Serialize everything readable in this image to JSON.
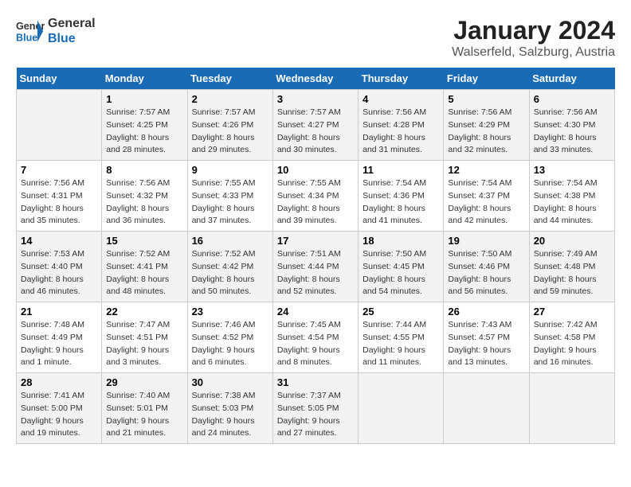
{
  "logo": {
    "text_general": "General",
    "text_blue": "Blue"
  },
  "title": "January 2024",
  "subtitle": "Walserfeld, Salzburg, Austria",
  "weekdays": [
    "Sunday",
    "Monday",
    "Tuesday",
    "Wednesday",
    "Thursday",
    "Friday",
    "Saturday"
  ],
  "weeks": [
    [
      {
        "day": "",
        "sunrise": "",
        "sunset": "",
        "daylight": ""
      },
      {
        "day": "1",
        "sunrise": "Sunrise: 7:57 AM",
        "sunset": "Sunset: 4:25 PM",
        "daylight": "Daylight: 8 hours and 28 minutes."
      },
      {
        "day": "2",
        "sunrise": "Sunrise: 7:57 AM",
        "sunset": "Sunset: 4:26 PM",
        "daylight": "Daylight: 8 hours and 29 minutes."
      },
      {
        "day": "3",
        "sunrise": "Sunrise: 7:57 AM",
        "sunset": "Sunset: 4:27 PM",
        "daylight": "Daylight: 8 hours and 30 minutes."
      },
      {
        "day": "4",
        "sunrise": "Sunrise: 7:56 AM",
        "sunset": "Sunset: 4:28 PM",
        "daylight": "Daylight: 8 hours and 31 minutes."
      },
      {
        "day": "5",
        "sunrise": "Sunrise: 7:56 AM",
        "sunset": "Sunset: 4:29 PM",
        "daylight": "Daylight: 8 hours and 32 minutes."
      },
      {
        "day": "6",
        "sunrise": "Sunrise: 7:56 AM",
        "sunset": "Sunset: 4:30 PM",
        "daylight": "Daylight: 8 hours and 33 minutes."
      }
    ],
    [
      {
        "day": "7",
        "sunrise": "Sunrise: 7:56 AM",
        "sunset": "Sunset: 4:31 PM",
        "daylight": "Daylight: 8 hours and 35 minutes."
      },
      {
        "day": "8",
        "sunrise": "Sunrise: 7:56 AM",
        "sunset": "Sunset: 4:32 PM",
        "daylight": "Daylight: 8 hours and 36 minutes."
      },
      {
        "day": "9",
        "sunrise": "Sunrise: 7:55 AM",
        "sunset": "Sunset: 4:33 PM",
        "daylight": "Daylight: 8 hours and 37 minutes."
      },
      {
        "day": "10",
        "sunrise": "Sunrise: 7:55 AM",
        "sunset": "Sunset: 4:34 PM",
        "daylight": "Daylight: 8 hours and 39 minutes."
      },
      {
        "day": "11",
        "sunrise": "Sunrise: 7:54 AM",
        "sunset": "Sunset: 4:36 PM",
        "daylight": "Daylight: 8 hours and 41 minutes."
      },
      {
        "day": "12",
        "sunrise": "Sunrise: 7:54 AM",
        "sunset": "Sunset: 4:37 PM",
        "daylight": "Daylight: 8 hours and 42 minutes."
      },
      {
        "day": "13",
        "sunrise": "Sunrise: 7:54 AM",
        "sunset": "Sunset: 4:38 PM",
        "daylight": "Daylight: 8 hours and 44 minutes."
      }
    ],
    [
      {
        "day": "14",
        "sunrise": "Sunrise: 7:53 AM",
        "sunset": "Sunset: 4:40 PM",
        "daylight": "Daylight: 8 hours and 46 minutes."
      },
      {
        "day": "15",
        "sunrise": "Sunrise: 7:52 AM",
        "sunset": "Sunset: 4:41 PM",
        "daylight": "Daylight: 8 hours and 48 minutes."
      },
      {
        "day": "16",
        "sunrise": "Sunrise: 7:52 AM",
        "sunset": "Sunset: 4:42 PM",
        "daylight": "Daylight: 8 hours and 50 minutes."
      },
      {
        "day": "17",
        "sunrise": "Sunrise: 7:51 AM",
        "sunset": "Sunset: 4:44 PM",
        "daylight": "Daylight: 8 hours and 52 minutes."
      },
      {
        "day": "18",
        "sunrise": "Sunrise: 7:50 AM",
        "sunset": "Sunset: 4:45 PM",
        "daylight": "Daylight: 8 hours and 54 minutes."
      },
      {
        "day": "19",
        "sunrise": "Sunrise: 7:50 AM",
        "sunset": "Sunset: 4:46 PM",
        "daylight": "Daylight: 8 hours and 56 minutes."
      },
      {
        "day": "20",
        "sunrise": "Sunrise: 7:49 AM",
        "sunset": "Sunset: 4:48 PM",
        "daylight": "Daylight: 8 hours and 59 minutes."
      }
    ],
    [
      {
        "day": "21",
        "sunrise": "Sunrise: 7:48 AM",
        "sunset": "Sunset: 4:49 PM",
        "daylight": "Daylight: 9 hours and 1 minute."
      },
      {
        "day": "22",
        "sunrise": "Sunrise: 7:47 AM",
        "sunset": "Sunset: 4:51 PM",
        "daylight": "Daylight: 9 hours and 3 minutes."
      },
      {
        "day": "23",
        "sunrise": "Sunrise: 7:46 AM",
        "sunset": "Sunset: 4:52 PM",
        "daylight": "Daylight: 9 hours and 6 minutes."
      },
      {
        "day": "24",
        "sunrise": "Sunrise: 7:45 AM",
        "sunset": "Sunset: 4:54 PM",
        "daylight": "Daylight: 9 hours and 8 minutes."
      },
      {
        "day": "25",
        "sunrise": "Sunrise: 7:44 AM",
        "sunset": "Sunset: 4:55 PM",
        "daylight": "Daylight: 9 hours and 11 minutes."
      },
      {
        "day": "26",
        "sunrise": "Sunrise: 7:43 AM",
        "sunset": "Sunset: 4:57 PM",
        "daylight": "Daylight: 9 hours and 13 minutes."
      },
      {
        "day": "27",
        "sunrise": "Sunrise: 7:42 AM",
        "sunset": "Sunset: 4:58 PM",
        "daylight": "Daylight: 9 hours and 16 minutes."
      }
    ],
    [
      {
        "day": "28",
        "sunrise": "Sunrise: 7:41 AM",
        "sunset": "Sunset: 5:00 PM",
        "daylight": "Daylight: 9 hours and 19 minutes."
      },
      {
        "day": "29",
        "sunrise": "Sunrise: 7:40 AM",
        "sunset": "Sunset: 5:01 PM",
        "daylight": "Daylight: 9 hours and 21 minutes."
      },
      {
        "day": "30",
        "sunrise": "Sunrise: 7:38 AM",
        "sunset": "Sunset: 5:03 PM",
        "daylight": "Daylight: 9 hours and 24 minutes."
      },
      {
        "day": "31",
        "sunrise": "Sunrise: 7:37 AM",
        "sunset": "Sunset: 5:05 PM",
        "daylight": "Daylight: 9 hours and 27 minutes."
      },
      {
        "day": "",
        "sunrise": "",
        "sunset": "",
        "daylight": ""
      },
      {
        "day": "",
        "sunrise": "",
        "sunset": "",
        "daylight": ""
      },
      {
        "day": "",
        "sunrise": "",
        "sunset": "",
        "daylight": ""
      }
    ]
  ]
}
